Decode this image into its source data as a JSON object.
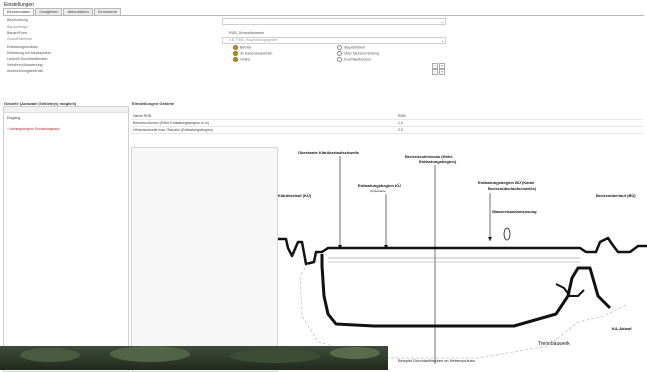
{
  "window": {
    "title": "Einstellungen"
  },
  "tabs": [
    "Beckendaten",
    "Ganglinien",
    "Ablaufdaten",
    "Kennwerte"
  ],
  "form": {
    "rows": [
      {
        "label": "Bezeichnung",
        "value": ""
      },
      {
        "label": "Bauwerkstyp",
        "value": ""
      },
      {
        "label": "Bauart/Form",
        "value": "RÜB_Drosselbauwerk"
      },
      {
        "label": "Zulauf/Sammler",
        "value": "z.B. RÜB_Haupteinzugsgebiet"
      },
      {
        "label": "Entlastungsfunktion",
        "value": ""
      },
      {
        "label": "Entlastung mit Messsystem",
        "value": ""
      },
      {
        "label": "Laufzeit Durchlaufbecken",
        "value": ""
      },
      {
        "label": "Verfahren/Auswertung",
        "value": ""
      },
      {
        "label": "Aufzeichnungsintervall",
        "value": ""
      }
    ],
    "radios_left": [
      "Betrieb",
      "im Dauerstaubetrieb",
      "Online"
    ],
    "radios_right": [
      "Stapelbetrieb",
      "Über Messvorrichtung",
      "Durchlaufbecken"
    ]
  },
  "left_panel": {
    "header": "Gebiete (Auswahl Gebiete(n) möglich)",
    "items": [
      "Eingang",
      "+ Anfangsbeginn Entlastungslauf"
    ]
  },
  "right_panel": {
    "header": "Einstellungen Gebiete",
    "rows": [
      {
        "label": "Name RÜB",
        "value": "RÜB",
        "unit": ""
      },
      {
        "label": "Beckenvolumen (Höhe Entlastungsbeginn in m)",
        "value": "",
        "unit": "1,0"
      },
      {
        "label": "Höhenschwelle max. Stauziel (Entlastungsbeginn)",
        "value": "",
        "unit": "2,0"
      }
    ]
  },
  "diagram": {
    "labels": {
      "oberkante": "Oberkante Klärüberlaufschwelle",
      "entlastung_ku": "Entlastungsbeginn KÜ",
      "entlastung_ku_sub": "(Unterkante",
      "beckensohle": "Beckensohlniveau (Höhe",
      "beckensohle2": "Entlastungsbeginn)",
      "entlastung_bu": "Entlastungsbeginn BÜ (Kante",
      "entlastung_bu2": "Beckenüberlaufschwelle)",
      "wasserstand": "Wasserstandsmessung",
      "left_label": "Klärüberlauf (KÜ)",
      "right_label": "Beckenüberlauf (BÜ)",
      "trennbauwerk": "Trennbauwerk",
      "ka_ablauf": "KA-Ablauf"
    }
  },
  "caption": "Beispiel Durchlaufbecken im Nebenschluss"
}
